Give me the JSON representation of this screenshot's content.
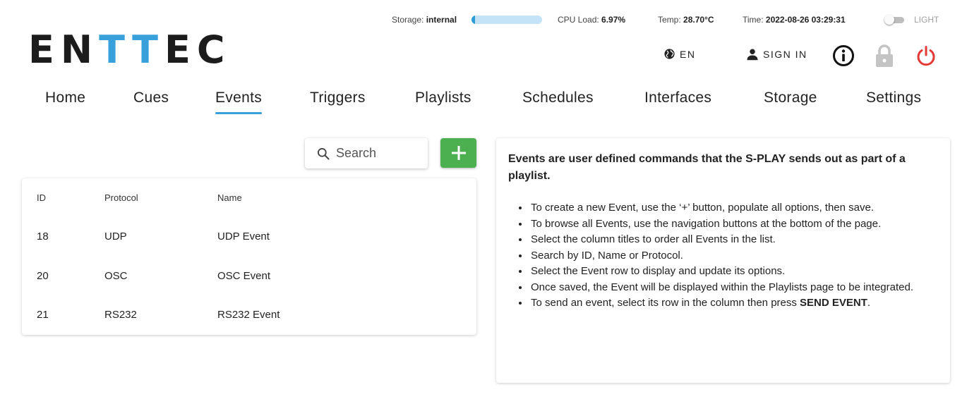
{
  "status": {
    "storage_label": "Storage:",
    "storage_value": "internal",
    "storage_fill_percent": 5,
    "cpu_label": "CPU Load:",
    "cpu_value": "6.97%",
    "temp_label": "Temp:",
    "temp_value": "28.70°C",
    "time_label": "Time:",
    "time_value": "2022-08-26 03:29:31",
    "theme_label": "LIGHT"
  },
  "logo": {
    "part1": "EN",
    "part2": "TT",
    "part3": "EC"
  },
  "actions": {
    "language": "EN",
    "sign_in": "SIGN IN"
  },
  "nav": {
    "tabs": [
      {
        "label": "Home"
      },
      {
        "label": "Cues"
      },
      {
        "label": "Events"
      },
      {
        "label": "Triggers"
      },
      {
        "label": "Playlists"
      },
      {
        "label": "Schedules"
      },
      {
        "label": "Interfaces"
      },
      {
        "label": "Storage"
      },
      {
        "label": "Settings"
      }
    ],
    "active": "Events"
  },
  "search": {
    "placeholder": "Search"
  },
  "table": {
    "headers": {
      "id": "ID",
      "protocol": "Protocol",
      "name": "Name"
    },
    "rows": [
      {
        "id": "18",
        "protocol": "UDP",
        "name": "UDP Event"
      },
      {
        "id": "20",
        "protocol": "OSC",
        "name": "OSC Event"
      },
      {
        "id": "21",
        "protocol": "RS232",
        "name": "RS232 Event"
      }
    ]
  },
  "info": {
    "title": "Events are user defined commands that the S-PLAY sends out as part of a playlist.",
    "bullets": [
      "To create a new Event, use the ‘+’ button, populate all options, then save.",
      "To browse all Events, use the navigation buttons at the bottom of the page.",
      "Select the column titles to order all Events in the list.",
      "Search by ID, Name or Protocol.",
      "Select the Event row to display and update its options.",
      "Once saved, the Event will be displayed within the Playlists page to be integrated."
    ],
    "last_bullet_prefix": "To send an event, select its row in the column then press ",
    "last_bullet_strong": "SEND EVENT",
    "last_bullet_suffix": "."
  },
  "colors": {
    "accent": "#3aa0dc",
    "add_button": "#4caf50",
    "power": "#e53935",
    "lock": "#c4c4c4"
  }
}
